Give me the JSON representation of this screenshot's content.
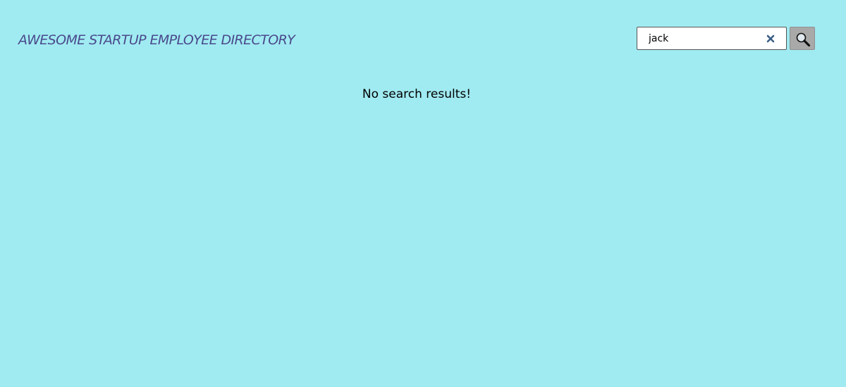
{
  "header": {
    "title": "AWESOME STARTUP EMPLOYEE DIRECTORY"
  },
  "search": {
    "value": "jack",
    "clear_icon": "close-icon",
    "submit_icon": "search-icon"
  },
  "results": {
    "message": "No search results!"
  },
  "colors": {
    "background": "#a0ebf1",
    "title": "#4a4a8c",
    "search_button": "#a9a9a9",
    "clear_icon": "#3b5f85"
  }
}
